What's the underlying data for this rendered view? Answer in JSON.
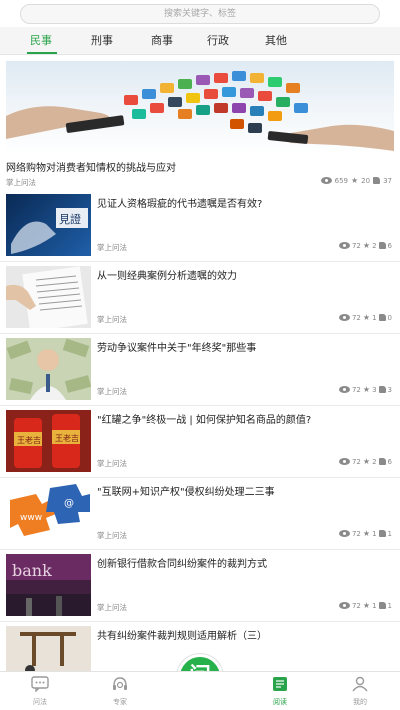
{
  "search": {
    "placeholder": "搜索关键字、标签"
  },
  "tabs": [
    {
      "label": "民事",
      "active": true
    },
    {
      "label": "刑事",
      "active": false
    },
    {
      "label": "商事",
      "active": false
    },
    {
      "label": "行政",
      "active": false
    },
    {
      "label": "其他",
      "active": false
    }
  ],
  "feature": {
    "title": "网络购物对消费者知情权的挑战与应对",
    "source": "掌上问法",
    "views": "659",
    "stars": "20",
    "likes": "37"
  },
  "articles": [
    {
      "title": "见证人资格瑕疵的代书遗嘱是否有效?",
      "source": "掌上问法",
      "views": "72",
      "stars": "2",
      "likes": "6"
    },
    {
      "title": "从一则经典案例分析遗嘱的效力",
      "source": "掌上问法",
      "views": "72",
      "stars": "1",
      "likes": "0"
    },
    {
      "title": "劳动争议案件中关于\"年终奖\"那些事",
      "source": "掌上问法",
      "views": "72",
      "stars": "3",
      "likes": "3"
    },
    {
      "title": "\"红罐之争\"终极一战 | 如何保护知名商品的颜值?",
      "source": "掌上问法",
      "views": "72",
      "stars": "2",
      "likes": "6"
    },
    {
      "title": "\"互联网+知识产权\"侵权纠纷处理二三事",
      "source": "掌上问法",
      "views": "72",
      "stars": "1",
      "likes": "1"
    },
    {
      "title": "创新银行借款合同纠纷案件的裁判方式",
      "source": "掌上问法",
      "views": "72",
      "stars": "1",
      "likes": "1"
    },
    {
      "title": "共有纠纷案件裁判规则适用解析（三）",
      "source": "",
      "views": "",
      "stars": "",
      "likes": ""
    }
  ],
  "thumb_text": {
    "witness": "見證",
    "bank": "bank",
    "can1": "王老吉",
    "can2": "王老吉",
    "puzzle": "www"
  },
  "nav": {
    "ask_label": "问法",
    "expert_label": "专家",
    "center_label": "问",
    "read_label": "阅读",
    "me_label": "我的"
  },
  "colors": {
    "accent": "#2aa44a",
    "center_button": "#27b14a"
  }
}
